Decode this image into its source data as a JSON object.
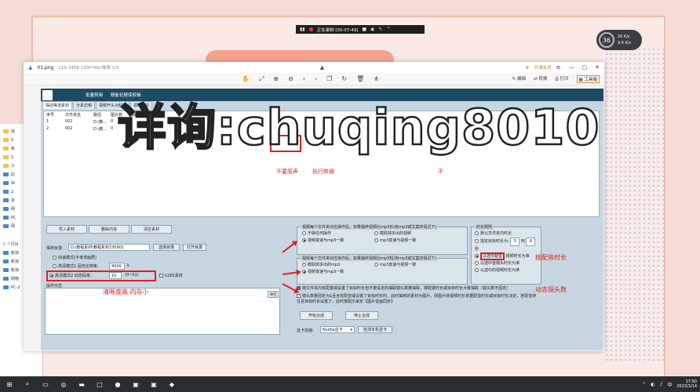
{
  "recorder": {
    "status": "正在录制 [00:07:49]"
  },
  "speed_widget": {
    "percent": "36",
    "up": "20 K/s",
    "down": "9.4 K/s"
  },
  "viewer": {
    "file_name": "01.png",
    "file_meta": "119.34KB  1500*692像素  1/5",
    "vip": "开通会员",
    "toolbar_right": [
      "编辑",
      "转换",
      "打印",
      "工具箱"
    ]
  },
  "app": {
    "menu": [
      "批量剪辑",
      "精能化随保剪辑"
    ],
    "tabs": [
      "探店等流素材",
      "分素剪辑",
      "视频开头对粘接",
      "视频合并"
    ],
    "table_headers": [
      "序号",
      "文件夹名",
      "路径",
      "图片数",
      "视频数"
    ],
    "table_rows": [
      [
        "1",
        "001",
        "D:\\教...",
        "0",
        "9"
      ],
      [
        "2",
        "002",
        "D:\\教...",
        "0",
        "9"
      ]
    ],
    "table_annotation_1": "不要原声",
    "table_annotation_2": "执行剪辑",
    "table_annotation_3": "不",
    "buttons": {
      "import": "导入素材",
      "delete": "删除内容",
      "clear": "清空素材",
      "select_dir": "选择目录",
      "open_dir": "打开目录",
      "clear_log": "清空",
      "start": "开始合成",
      "stop": "停止合成",
      "detect_gpu": "检测本机显卡"
    },
    "save_label": "保存目录:",
    "save_path": "D:\\教程素材\\教程素材230901",
    "mode_fast": "快速模式(不考虑画质)",
    "mode_hq1": "高清模式1 固定比特率:",
    "mode_hq1_value": "4000",
    "mode_hq1_unit": "k",
    "mode_hq2": "高清模式2 动态码率:",
    "mode_hq2_value": "10",
    "mode_hq2_range": "(0~51)",
    "h265": "h265素材",
    "log_label": "操作日志",
    "annotation_clarity": "清晰度高 内存小",
    "group1_title": "视频每个文件夹对应操作后，如果最终视频比mp3长(有mp3或文案的情况下)",
    "group1_opts": [
      "不做任何操作",
      "截取掉多出的视频",
      "视频变速与mp3一致",
      "mp3变速与视频一致"
    ],
    "group2_title": "视频每个文件夹对应操作后，如果最终视频比mp3短(有mp3或文案的情况下)",
    "group2_opts": [
      "截取掉多出的mp3",
      "mp3变速与视频一致",
      "视频变速与mp3一致"
    ],
    "duration_title": "时长规则",
    "duration_opts": [
      "默认文件夹内时长",
      "指定目标时长为:",
      "以选中配音",
      "以选中首镜头时长为准",
      "以选中的视频时长为准"
    ],
    "duration_from": "5",
    "duration_to_label": "到",
    "duration_to": "6",
    "duration_unit": "秒",
    "duration_extra": "视频时长为准",
    "annotation_dub": "按配音时长",
    "check1": "按文件夹内有配置或设置了目标时长但不按设定的抽取镜头数量抽取，按配置时长或目标时长大致抽取（镜头数不固定）",
    "check2": "镜头数量固定为1且含有配音或设置了目标时长时，此时抽到的素材为图片，则图片转视频时长依据配音时长或目标时长决定，若配音存在且目标时长设置了，此时按配乐来定【图片音画同步】",
    "annotation_dynamic": "动态镜头数",
    "gpu_label": "显卡加速:",
    "gpu_value": "Nvidia显卡"
  },
  "watermark": "详询:chuqing8010",
  "explorer": {
    "items": [
      "快",
      "0",
      "新",
      "2",
      "小",
      "此",
      "W",
      "2",
      "本",
      "网",
      "PC",
      "网"
    ],
    "count": "5 个项目",
    "bottom": [
      "新加",
      "新加",
      "新加",
      "网络",
      "PC-2"
    ]
  },
  "taskbar": {
    "time": "17:50",
    "date": "2023/3/14",
    "ime": "中"
  }
}
